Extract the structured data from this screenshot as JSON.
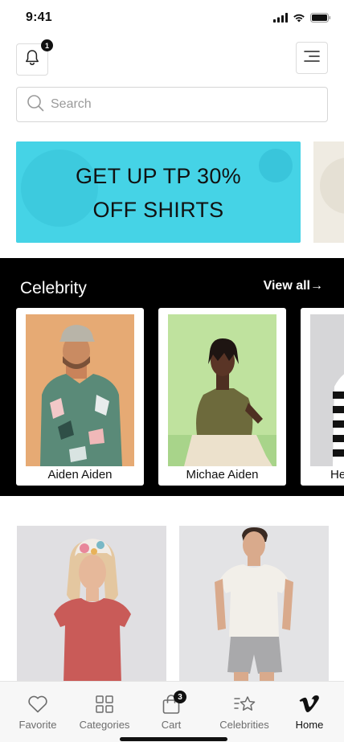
{
  "status_bar": {
    "time": "9:41"
  },
  "header": {
    "notification_count": "1"
  },
  "search": {
    "placeholder": "Search"
  },
  "banner": {
    "line1": "GET UP TP 30%",
    "line2": "OFF SHIRTS",
    "color": "#45d3e6"
  },
  "celebrity": {
    "title": "Celebrity",
    "view_all": "View all→",
    "items": [
      {
        "name": "Aiden Aiden"
      },
      {
        "name": "Michae Aiden"
      },
      {
        "name": "He"
      }
    ]
  },
  "bottom_nav": {
    "items": [
      {
        "label": "Favorite",
        "icon": "heart-icon"
      },
      {
        "label": "Categories",
        "icon": "grid-icon"
      },
      {
        "label": "Cart",
        "icon": "bag-icon",
        "badge": "3"
      },
      {
        "label": "Celebrities",
        "icon": "star-list-icon"
      },
      {
        "label": "Home",
        "icon": "vimeo-icon",
        "active": true
      }
    ]
  }
}
